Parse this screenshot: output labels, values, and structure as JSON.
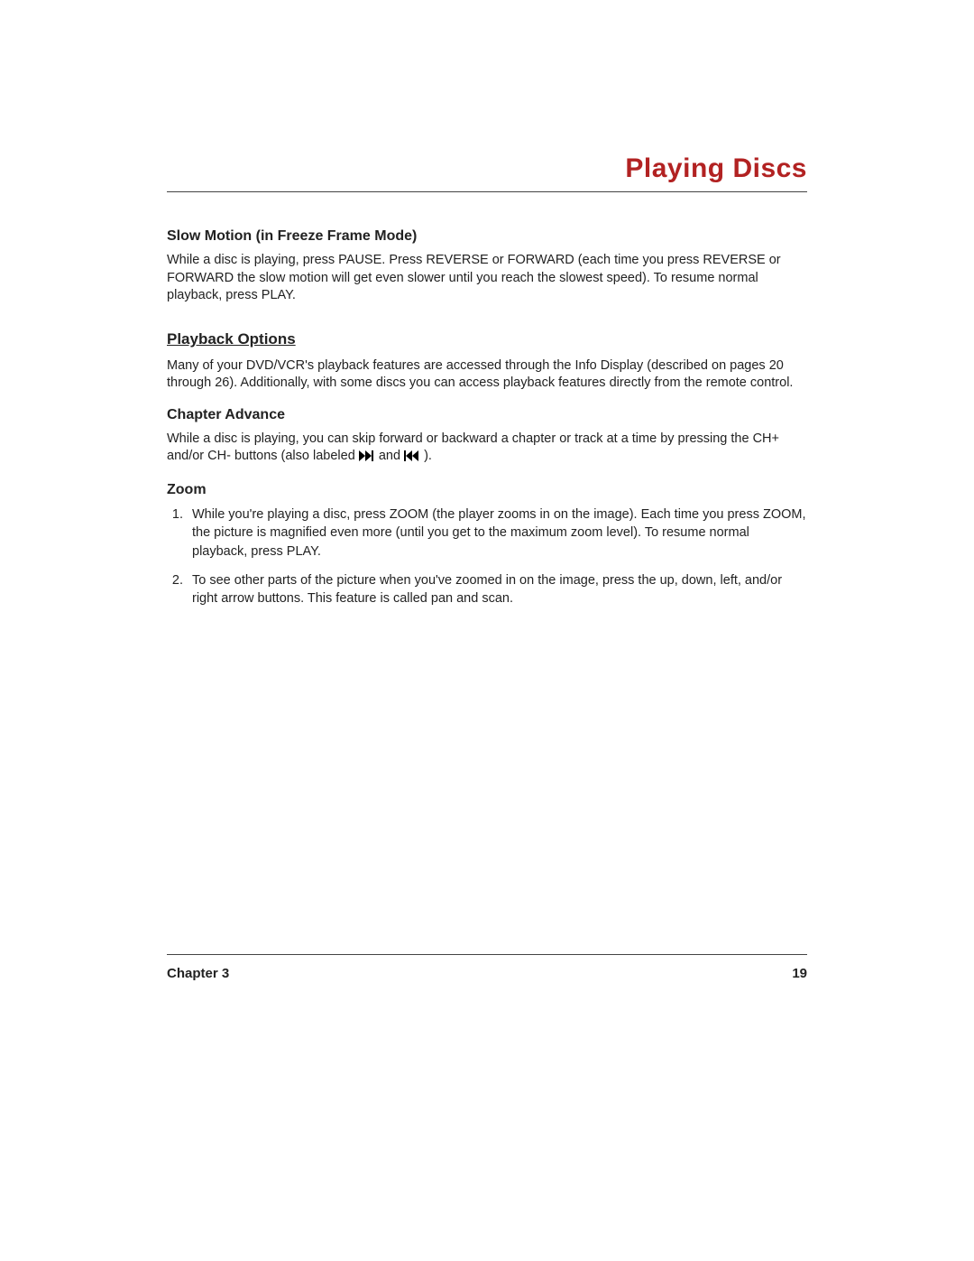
{
  "page_title": "Playing Discs",
  "sections": {
    "slow_motion": {
      "heading": "Slow Motion (in Freeze Frame Mode)",
      "body": "While a disc is playing, press PAUSE. Press REVERSE or FORWARD (each time you press REVERSE or FORWARD the slow motion will get even slower until you reach the slowest speed). To resume normal playback, press PLAY."
    },
    "playback_options": {
      "heading": "Playback Options",
      "body": "Many of your DVD/VCR's playback features are accessed through the Info Display (described on pages 20 through 26). Additionally, with some discs you can access playback features directly from the remote control."
    },
    "chapter_advance": {
      "heading": "Chapter Advance",
      "body_pre": "While a disc is playing, you can skip forward or backward a chapter or track at a time by pressing the CH+ and/or CH- buttons (also labeled ",
      "body_mid": " and ",
      "body_post": " )."
    },
    "zoom": {
      "heading": "Zoom",
      "items": [
        "While you're playing a disc, press ZOOM (the player zooms in on the image). Each time you press ZOOM, the picture is magnified even more (until you get to the maximum zoom level). To resume normal playback, press PLAY.",
        "To see other parts of the picture when you've zoomed in on the image, press the up, down, left, and/or right arrow buttons. This feature is called pan and scan."
      ]
    }
  },
  "footer": {
    "chapter_label": "Chapter 3",
    "page_number": "19"
  }
}
